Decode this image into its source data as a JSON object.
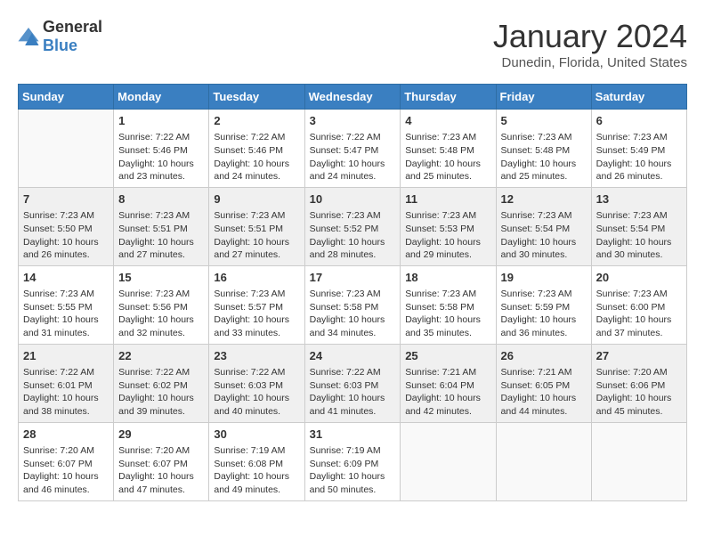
{
  "header": {
    "logo_general": "General",
    "logo_blue": "Blue",
    "title": "January 2024",
    "subtitle": "Dunedin, Florida, United States"
  },
  "columns": [
    "Sunday",
    "Monday",
    "Tuesday",
    "Wednesday",
    "Thursday",
    "Friday",
    "Saturday"
  ],
  "weeks": [
    [
      {
        "num": "",
        "info": ""
      },
      {
        "num": "1",
        "info": "Sunrise: 7:22 AM\nSunset: 5:46 PM\nDaylight: 10 hours\nand 23 minutes."
      },
      {
        "num": "2",
        "info": "Sunrise: 7:22 AM\nSunset: 5:46 PM\nDaylight: 10 hours\nand 24 minutes."
      },
      {
        "num": "3",
        "info": "Sunrise: 7:22 AM\nSunset: 5:47 PM\nDaylight: 10 hours\nand 24 minutes."
      },
      {
        "num": "4",
        "info": "Sunrise: 7:23 AM\nSunset: 5:48 PM\nDaylight: 10 hours\nand 25 minutes."
      },
      {
        "num": "5",
        "info": "Sunrise: 7:23 AM\nSunset: 5:48 PM\nDaylight: 10 hours\nand 25 minutes."
      },
      {
        "num": "6",
        "info": "Sunrise: 7:23 AM\nSunset: 5:49 PM\nDaylight: 10 hours\nand 26 minutes."
      }
    ],
    [
      {
        "num": "7",
        "info": "Sunrise: 7:23 AM\nSunset: 5:50 PM\nDaylight: 10 hours\nand 26 minutes."
      },
      {
        "num": "8",
        "info": "Sunrise: 7:23 AM\nSunset: 5:51 PM\nDaylight: 10 hours\nand 27 minutes."
      },
      {
        "num": "9",
        "info": "Sunrise: 7:23 AM\nSunset: 5:51 PM\nDaylight: 10 hours\nand 27 minutes."
      },
      {
        "num": "10",
        "info": "Sunrise: 7:23 AM\nSunset: 5:52 PM\nDaylight: 10 hours\nand 28 minutes."
      },
      {
        "num": "11",
        "info": "Sunrise: 7:23 AM\nSunset: 5:53 PM\nDaylight: 10 hours\nand 29 minutes."
      },
      {
        "num": "12",
        "info": "Sunrise: 7:23 AM\nSunset: 5:54 PM\nDaylight: 10 hours\nand 30 minutes."
      },
      {
        "num": "13",
        "info": "Sunrise: 7:23 AM\nSunset: 5:54 PM\nDaylight: 10 hours\nand 30 minutes."
      }
    ],
    [
      {
        "num": "14",
        "info": "Sunrise: 7:23 AM\nSunset: 5:55 PM\nDaylight: 10 hours\nand 31 minutes."
      },
      {
        "num": "15",
        "info": "Sunrise: 7:23 AM\nSunset: 5:56 PM\nDaylight: 10 hours\nand 32 minutes."
      },
      {
        "num": "16",
        "info": "Sunrise: 7:23 AM\nSunset: 5:57 PM\nDaylight: 10 hours\nand 33 minutes."
      },
      {
        "num": "17",
        "info": "Sunrise: 7:23 AM\nSunset: 5:58 PM\nDaylight: 10 hours\nand 34 minutes."
      },
      {
        "num": "18",
        "info": "Sunrise: 7:23 AM\nSunset: 5:58 PM\nDaylight: 10 hours\nand 35 minutes."
      },
      {
        "num": "19",
        "info": "Sunrise: 7:23 AM\nSunset: 5:59 PM\nDaylight: 10 hours\nand 36 minutes."
      },
      {
        "num": "20",
        "info": "Sunrise: 7:23 AM\nSunset: 6:00 PM\nDaylight: 10 hours\nand 37 minutes."
      }
    ],
    [
      {
        "num": "21",
        "info": "Sunrise: 7:22 AM\nSunset: 6:01 PM\nDaylight: 10 hours\nand 38 minutes."
      },
      {
        "num": "22",
        "info": "Sunrise: 7:22 AM\nSunset: 6:02 PM\nDaylight: 10 hours\nand 39 minutes."
      },
      {
        "num": "23",
        "info": "Sunrise: 7:22 AM\nSunset: 6:03 PM\nDaylight: 10 hours\nand 40 minutes."
      },
      {
        "num": "24",
        "info": "Sunrise: 7:22 AM\nSunset: 6:03 PM\nDaylight: 10 hours\nand 41 minutes."
      },
      {
        "num": "25",
        "info": "Sunrise: 7:21 AM\nSunset: 6:04 PM\nDaylight: 10 hours\nand 42 minutes."
      },
      {
        "num": "26",
        "info": "Sunrise: 7:21 AM\nSunset: 6:05 PM\nDaylight: 10 hours\nand 44 minutes."
      },
      {
        "num": "27",
        "info": "Sunrise: 7:20 AM\nSunset: 6:06 PM\nDaylight: 10 hours\nand 45 minutes."
      }
    ],
    [
      {
        "num": "28",
        "info": "Sunrise: 7:20 AM\nSunset: 6:07 PM\nDaylight: 10 hours\nand 46 minutes."
      },
      {
        "num": "29",
        "info": "Sunrise: 7:20 AM\nSunset: 6:07 PM\nDaylight: 10 hours\nand 47 minutes."
      },
      {
        "num": "30",
        "info": "Sunrise: 7:19 AM\nSunset: 6:08 PM\nDaylight: 10 hours\nand 49 minutes."
      },
      {
        "num": "31",
        "info": "Sunrise: 7:19 AM\nSunset: 6:09 PM\nDaylight: 10 hours\nand 50 minutes."
      },
      {
        "num": "",
        "info": ""
      },
      {
        "num": "",
        "info": ""
      },
      {
        "num": "",
        "info": ""
      }
    ]
  ]
}
